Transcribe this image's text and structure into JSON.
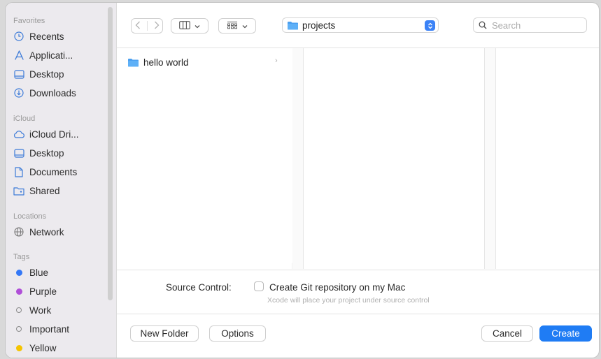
{
  "sidebar": {
    "favorites_title": "Favorites",
    "favorites": [
      {
        "label": "Recents",
        "icon": "clock-icon"
      },
      {
        "label": "Applicati...",
        "icon": "applications-icon"
      },
      {
        "label": "Desktop",
        "icon": "desktop-icon"
      },
      {
        "label": "Downloads",
        "icon": "downloads-icon"
      }
    ],
    "icloud_title": "iCloud",
    "icloud": [
      {
        "label": "iCloud Dri...",
        "icon": "cloud-icon"
      },
      {
        "label": "Desktop",
        "icon": "desktop-icon"
      },
      {
        "label": "Documents",
        "icon": "document-icon"
      },
      {
        "label": "Shared",
        "icon": "shared-folder-icon"
      }
    ],
    "locations_title": "Locations",
    "locations": [
      {
        "label": "Network",
        "icon": "globe-icon"
      }
    ],
    "tags_title": "Tags",
    "tags": [
      {
        "label": "Blue",
        "color": "#3478f6"
      },
      {
        "label": "Purple",
        "color": "#b04fd8"
      },
      {
        "label": "Work",
        "color": ""
      },
      {
        "label": "Important",
        "color": ""
      },
      {
        "label": "Yellow",
        "color": "#f5c400"
      }
    ]
  },
  "toolbar": {
    "location": "projects",
    "search_placeholder": "Search"
  },
  "browser": {
    "column1": [
      {
        "label": "hello world",
        "icon": "folder-icon"
      }
    ]
  },
  "options": {
    "source_control_label": "Source Control:",
    "git_checkbox_label": "Create Git repository on my Mac",
    "git_checked": false,
    "hint": "Xcode will place your project under source control"
  },
  "footer": {
    "new_folder": "New Folder",
    "options": "Options",
    "cancel": "Cancel",
    "create": "Create"
  },
  "colors": {
    "accent": "#1f7cf4",
    "folder": "#4a9ff0"
  }
}
